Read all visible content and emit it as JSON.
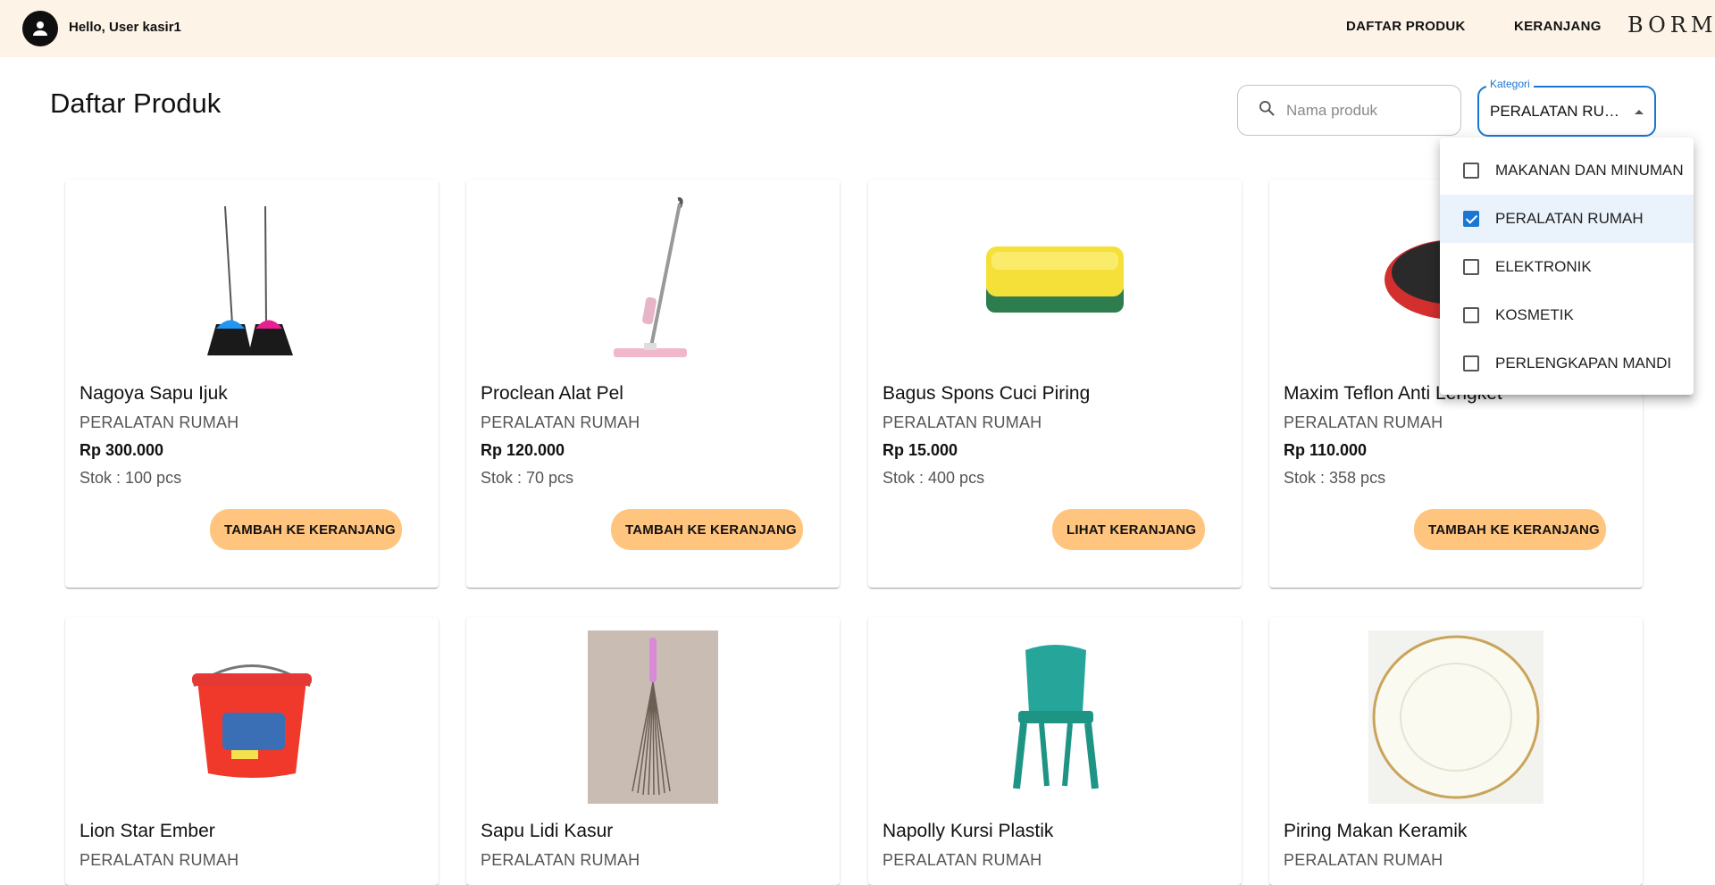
{
  "header": {
    "greeting": "Hello, User kasir1",
    "nav": [
      "DAFTAR PRODUK",
      "KERANJANG"
    ],
    "brand": "BORMI"
  },
  "page": {
    "title": "Daftar Produk"
  },
  "search": {
    "placeholder": "Nama produk",
    "value": ""
  },
  "category_filter": {
    "label": "Kategori",
    "value": "PERALATAN RUM...",
    "options": [
      {
        "label": "MAKANAN DAN MINUMAN",
        "checked": false
      },
      {
        "label": "PERALATAN RUMAH",
        "checked": true
      },
      {
        "label": "ELEKTRONIK",
        "checked": false
      },
      {
        "label": "KOSMETIK",
        "checked": false
      },
      {
        "label": "PERLENGKAPAN MANDI",
        "checked": false
      }
    ]
  },
  "products": [
    {
      "name": "Nagoya Sapu Ijuk",
      "category": "PERALATAN RUMAH",
      "price": "Rp 300.000",
      "stock": "Stok : 100 pcs",
      "button": "TAMBAH KE KERANJANG",
      "image": "broom-icon"
    },
    {
      "name": "Proclean Alat Pel",
      "category": "PERALATAN RUMAH",
      "price": "Rp 120.000",
      "stock": "Stok : 70 pcs",
      "button": "TAMBAH KE KERANJANG",
      "image": "mop-icon"
    },
    {
      "name": "Bagus Spons Cuci Piring",
      "category": "PERALATAN RUMAH",
      "price": "Rp 15.000",
      "stock": "Stok : 400 pcs",
      "button": "LIHAT KERANJANG",
      "image": "sponge-icon"
    },
    {
      "name": "Maxim Teflon Anti Lengket",
      "category": "PERALATAN RUMAH",
      "price": "Rp 110.000",
      "stock": "Stok : 358 pcs",
      "button": "TAMBAH KE KERANJANG",
      "image": "wok-icon"
    },
    {
      "name": "Lion Star Ember",
      "category": "PERALATAN RUMAH",
      "image": "bucket-icon"
    },
    {
      "name": "Sapu Lidi Kasur",
      "category": "PERALATAN RUMAH",
      "image": "stick-broom-icon"
    },
    {
      "name": "Napolly Kursi Plastik",
      "category": "PERALATAN RUMAH",
      "image": "chair-icon"
    },
    {
      "name": "Piring Makan Keramik",
      "category": "PERALATAN RUMAH",
      "image": "plate-icon"
    }
  ]
}
